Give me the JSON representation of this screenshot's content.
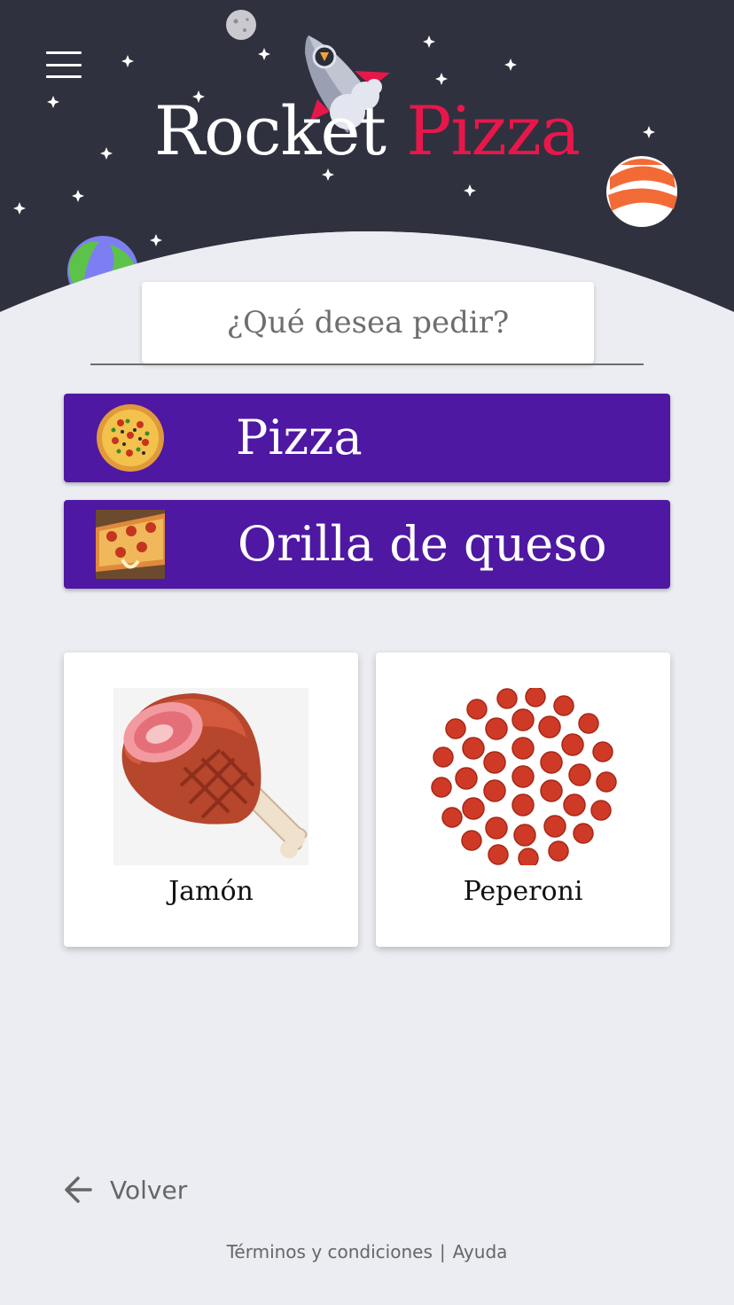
{
  "header": {
    "title_part1": "Rocket",
    "title_part2": "Pizza",
    "menu_icon": "hamburger-menu-icon",
    "colors": {
      "sky": "#30313f",
      "title_accent": "#e8174a",
      "title_primary": "#ffffff"
    }
  },
  "question": {
    "text": "¿Qué desea pedir?"
  },
  "categories": [
    {
      "label": "Pizza",
      "icon": "pizza-image"
    },
    {
      "label": "Orilla de queso",
      "icon": "cheese-crust-image"
    }
  ],
  "ingredients": [
    {
      "label": "Jamón",
      "icon": "ham-image"
    },
    {
      "label": "Peperoni",
      "icon": "pepperoni-image"
    }
  ],
  "navigation": {
    "back_label": "Volver",
    "back_icon": "arrow-left-icon"
  },
  "footer": {
    "terms": "Términos y condiciones",
    "separator": "|",
    "help": "Ayuda"
  },
  "theme": {
    "category_button_color": "#4e18a2",
    "background": "#ecedf2"
  }
}
